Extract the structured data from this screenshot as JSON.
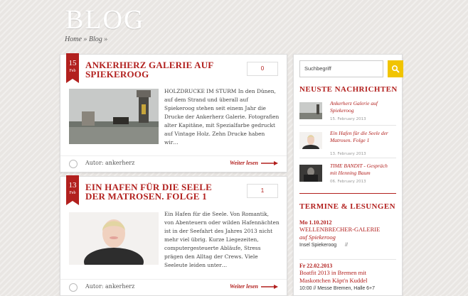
{
  "header": {
    "title": "BLOG",
    "breadcrumb": [
      "Home",
      "»",
      "Blog",
      "»"
    ]
  },
  "posts": [
    {
      "day": "15",
      "month": "Feb",
      "title": "Ankerherz Galerie auf Spiekeroog",
      "count": "0",
      "excerpt": "HOLZDRUCKE IM STURM In den Dünen, auf dem Strand und überall auf Spiekeroog stehen seit einem Jahr die Drucke der Ankerherz Galerie. Fotografien alter Kapitäne, mit Spezialfarbe gedruckt auf Vintage Holz. Zehn Drucke haben wir…",
      "author": "Autor: ankerherz",
      "more": "Weiter lesen"
    },
    {
      "day": "13",
      "month": "Feb",
      "title": "Ein Hafen für die Seele der Matrosen. Folge 1",
      "count": "1",
      "excerpt": "Ein Hafen für die Seele.  Von Romantik, von Abenteuern oder wilden Hafennächten ist in der Seefahrt des Jahres 2013 nicht mehr viel übrig. Kurze Liegezeiten, computergesteuerte Abläufe, Stress prägen den Alltag der Crews. Viele Seeleute leiden unter…",
      "author": "Autor: ankerherz",
      "more": "Weiter lesen"
    }
  ],
  "sidebar": {
    "search_value": "Suchbegriff",
    "news_title": "Neuste Nachrichten",
    "news": [
      {
        "title": "Ankerherz Galerie auf Spiekeroog",
        "date": "15. February 2013"
      },
      {
        "title": "Ein Hafen für die Seele der Matrosen. Folge 1",
        "date": "13. February 2013"
      },
      {
        "title": "TIME BANDIT - Gespräch mit Henning Baum",
        "date": "06. February 2013"
      }
    ],
    "events_title": "Termine & Lesungen",
    "events": [
      {
        "date": "Mo  1.10.2012",
        "title": "WELLENBRECHER-GALERIE",
        "sub": "auf Spiekeroog",
        "loc": "Insel Spiekeroog",
        "sep": "//"
      },
      {
        "date": "Fr 22.02.2013",
        "title": "Boatfit 2013 in Bremen mit",
        "sub": "Maskottchen Käpt'n Kuddel",
        "loc": "10:00  //  Messe Bremen, Halle 6+7",
        "sep": ""
      }
    ]
  },
  "colors": {
    "accent": "#b2201e",
    "search_button": "#f1c400"
  }
}
